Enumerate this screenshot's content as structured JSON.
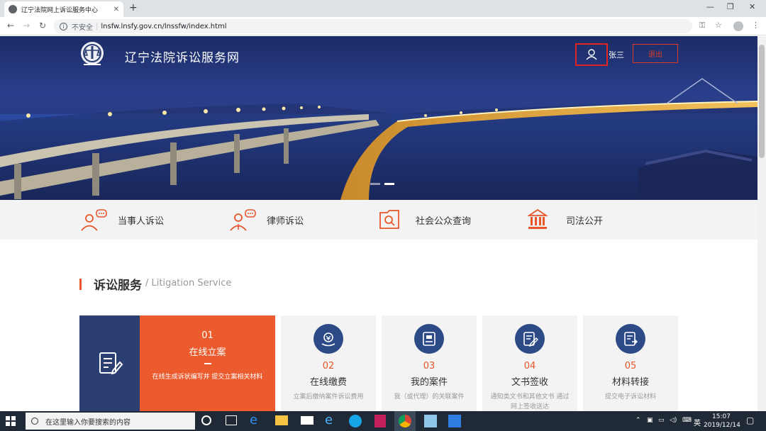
{
  "browser": {
    "tab_title": "辽宁法院网上诉讼服务中心",
    "address_insecure": "不安全",
    "address_url": "lnsfw.lnsfy.gov.cn/lnssfw/index.html"
  },
  "header": {
    "site_title": "辽宁法院诉讼服务网",
    "username": "张三",
    "logout_label": "退出"
  },
  "categories": [
    {
      "label": "当事人诉讼",
      "icon": "litigant-icon"
    },
    {
      "label": "律师诉讼",
      "icon": "lawyer-icon"
    },
    {
      "label": "社会公众查询",
      "icon": "public-query-icon"
    },
    {
      "label": "司法公开",
      "icon": "judicial-open-icon"
    }
  ],
  "section": {
    "title": "诉讼服务",
    "subtitle": "/ Litigation Service"
  },
  "services": [
    {
      "num": "01",
      "title": "在线立案",
      "desc": "在线生成诉状编写并 提交立案相关材料"
    },
    {
      "num": "02",
      "title": "在线缴费",
      "desc": "立案后缴纳案件诉讼费用"
    },
    {
      "num": "03",
      "title": "我的案件",
      "desc": "我（或代理）的关联案件"
    },
    {
      "num": "04",
      "title": "文书签收",
      "desc": "通知类文书和其他文书 通过网上签收送达"
    },
    {
      "num": "05",
      "title": "材料转接",
      "desc": "提交电子诉讼材料"
    }
  ],
  "taskbar": {
    "search_placeholder": "在这里输入你要搜索的内容",
    "lang": "英",
    "time": "15:07",
    "date": "2019/12/14"
  },
  "colors": {
    "accent": "#eb5b2e",
    "navy": "#2c3f72",
    "highlight_box": "#e02424"
  }
}
